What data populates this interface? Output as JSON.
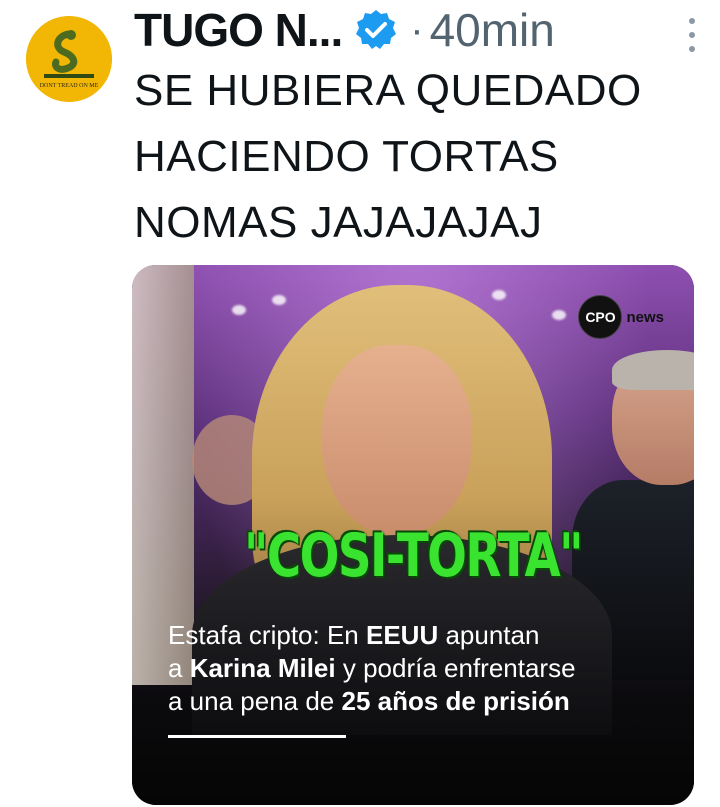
{
  "author": {
    "name": "TUGO N...",
    "verified": true,
    "avatar_icon": "gadsden-snake-avatar-icon",
    "avatar_text": "DONT TREAD ON ME"
  },
  "meta": {
    "separator": "·",
    "timestamp": "40min",
    "more_icon": "vertical-dots-icon"
  },
  "tweet": {
    "lines": [
      "SE HUBIERA QUEDADO",
      "HACIENDO TORTAS",
      "NOMAS JAJAJAJAJ"
    ]
  },
  "media": {
    "logo_mark": "CPO",
    "logo_word": "news",
    "headline": "\"COSI-TORTA\"",
    "caption": {
      "l1_a": "Estafa cripto: En ",
      "l1_b": "EEUU",
      "l1_c": " apuntan",
      "l2_a": "a ",
      "l2_b": "Karina Milei",
      "l2_c": " y podría enfrentarse",
      "l3_a": "a una pena de ",
      "l3_b": "25 años de prisión"
    }
  },
  "colors": {
    "headline_green": "#39e32f",
    "verified_blue": "#1d9bf0",
    "muted": "#536471"
  }
}
